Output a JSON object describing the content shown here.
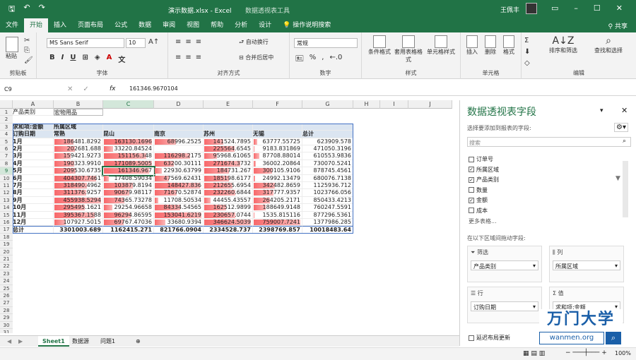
{
  "titlebar": {
    "file": "演示数据.xlsx - Excel",
    "context_tab": "数据透视表工具",
    "user": "王佩丰"
  },
  "menu": [
    "文件",
    "开始",
    "插入",
    "页面布局",
    "公式",
    "数据",
    "审阅",
    "视图",
    "帮助",
    "分析",
    "设计",
    "操作说明搜索"
  ],
  "menu_share": "共享",
  "ribbon": {
    "paste": "粘贴",
    "font_name": "MS Sans Serif",
    "font_size": "10",
    "wrap": "自动换行",
    "merge": "合并后居中",
    "number_format": "常规",
    "cond_format": "条件格式",
    "table_format": "套用表格格式",
    "cell_style": "单元格样式",
    "insert": "插入",
    "delete": "删除",
    "format": "格式",
    "sort": "排序和筛选",
    "find": "查找和选择",
    "groups": [
      "剪贴板",
      "字体",
      "对齐方式",
      "数字",
      "样式",
      "单元格",
      "编辑"
    ]
  },
  "formula": {
    "namebox": "C9",
    "value": "161346.9670104"
  },
  "columns": [
    "A",
    "B",
    "C",
    "D",
    "E",
    "F",
    "G",
    "H",
    "I",
    "J"
  ],
  "filter": {
    "label": "产品类别",
    "value": "宏物用品"
  },
  "pivot": {
    "corner": "求和项:金额",
    "col_field": "所属区域",
    "row_field": "订购日期",
    "headers": [
      "常熟",
      "昆山",
      "南京",
      "苏州",
      "无锡",
      "总计"
    ],
    "rows": [
      {
        "label": "1月",
        "vals": [
          "186481.8292",
          "163130.1696",
          "68996.2525",
          "141524.7895",
          "63777.55725",
          "623909.578"
        ]
      },
      {
        "label": "2月",
        "vals": [
          "202681.688",
          "33220.84524",
          "",
          "225564.6545",
          "9183.831869",
          "471050.3196"
        ]
      },
      {
        "label": "3月",
        "vals": [
          "159421.9273",
          "151156.348",
          "116298.2175",
          "95968.61065",
          "87708.88014",
          "610553.9836"
        ]
      },
      {
        "label": "4月",
        "vals": [
          "190323.9910",
          "171089.5005",
          "63200.30111",
          "271674.3732",
          "36002.20864",
          "730070.5241"
        ]
      },
      {
        "label": "5月",
        "vals": [
          "209530.6735",
          "161346.967",
          "22930.63799",
          "184731.267",
          "300105.9106",
          "878745.4561"
        ]
      },
      {
        "label": "6月",
        "vals": [
          "404307.7461",
          "17408.59034",
          "47569.62431",
          "185198.6177",
          "24992.13479",
          "680076.7138"
        ]
      },
      {
        "label": "7月",
        "vals": [
          "318490.4962",
          "103879.8194",
          "148427.836",
          "212655.6954",
          "342482.8659",
          "1125936.712"
        ]
      },
      {
        "label": "8月",
        "vals": [
          "311376.9257",
          "90679.98117",
          "71670.52874",
          "232260.6844",
          "317777.9357",
          "1023766.056"
        ]
      },
      {
        "label": "9月",
        "vals": [
          "455938.5294",
          "74365.73278",
          "11708.50534",
          "44455.43557",
          "264205.2171",
          "850433.4213"
        ]
      },
      {
        "label": "10月",
        "vals": [
          "295495.1621",
          "29254.96658",
          "84334.54565",
          "162512.9899",
          "188649.9148",
          "760247.5591"
        ]
      },
      {
        "label": "11月",
        "vals": [
          "395367.1588",
          "96294.86595",
          "153041.6219",
          "230657.0744",
          "1535.815116",
          "877296.5361"
        ]
      },
      {
        "label": "12月",
        "vals": [
          "107927.5015",
          "69767.47036",
          "33680.9394",
          "346624.5039",
          "759007.7241",
          "1377986.285"
        ]
      }
    ],
    "total": {
      "label": "总计",
      "vals": [
        "3301003.689",
        "1162415.271",
        "821766.0904",
        "2334528.737",
        "2398769.857",
        "10018483.64"
      ]
    }
  },
  "bars": [
    [
      0.41,
      1.0,
      0.45,
      0.41,
      0.08
    ],
    [
      0.44,
      0.19,
      0,
      0.65,
      0.01
    ],
    [
      0.35,
      0.88,
      0.76,
      0.28,
      0.12
    ],
    [
      0.42,
      1.0,
      0.41,
      0.78,
      0.05
    ],
    [
      0.46,
      0.94,
      0.15,
      0.53,
      0.4
    ],
    [
      0.89,
      0.1,
      0.31,
      0.53,
      0.03
    ],
    [
      0.7,
      0.61,
      0.97,
      0.61,
      0.45
    ],
    [
      0.68,
      0.53,
      0.47,
      0.67,
      0.42
    ],
    [
      1.0,
      0.43,
      0.08,
      0.13,
      0.35
    ],
    [
      0.65,
      0.17,
      0.55,
      0.47,
      0.25
    ],
    [
      0.87,
      0.56,
      1.0,
      0.66,
      0.01
    ],
    [
      0.24,
      0.41,
      0.22,
      1.0,
      1.0
    ]
  ],
  "rownums": [
    "1",
    "2",
    "3",
    "4",
    "5",
    "6",
    "7",
    "8",
    "9",
    "10",
    "11",
    "12",
    "13",
    "14",
    "15",
    "16",
    "17",
    "18",
    "19",
    "20",
    "21",
    "22",
    "23",
    "24",
    "25",
    "26",
    "27",
    "28",
    "29",
    "30",
    "31"
  ],
  "tabs": [
    "Sheet1",
    "数据源",
    "问题1"
  ],
  "pane": {
    "title": "数据透视表字段",
    "subtitle": "选择要添加到报表的字段:",
    "search": "搜索",
    "fields": [
      {
        "name": "订单号",
        "checked": false
      },
      {
        "name": "所属区域",
        "checked": true
      },
      {
        "name": "产品类别",
        "checked": true
      },
      {
        "name": "数量",
        "checked": false
      },
      {
        "name": "金额",
        "checked": true
      },
      {
        "name": "成本",
        "checked": false
      }
    ],
    "more": "更多表格...",
    "drag": "在以下区域间拖动字段:",
    "filter_h": "筛选",
    "filter_v": "产品类别",
    "col_h": "列",
    "col_v": "所属区域",
    "row_h": "行",
    "row_v": "订购日期",
    "val_h": "值",
    "val_v": "求和项:金额",
    "defer": "延迟布局更新"
  },
  "logo": {
    "brand": "万门大学",
    "url": "wanmen.org"
  },
  "status": {
    "zoom": "100%"
  }
}
